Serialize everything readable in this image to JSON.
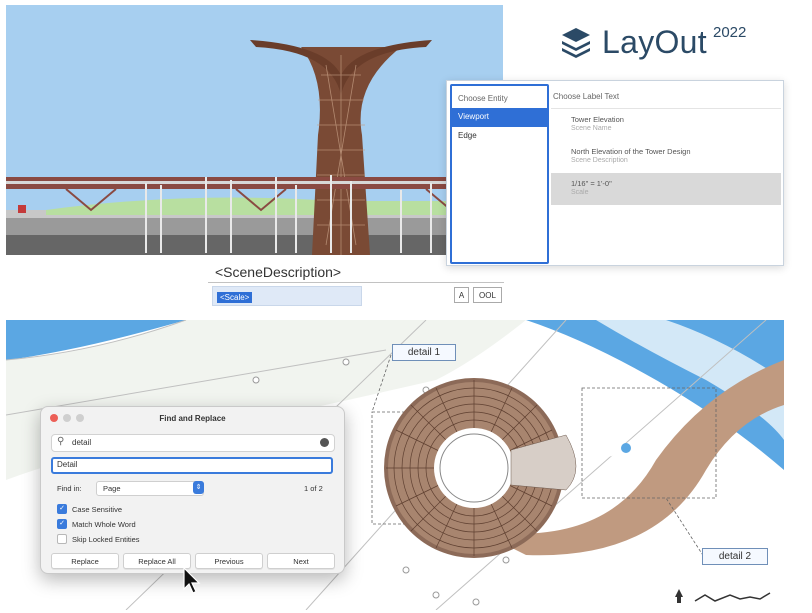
{
  "brand": {
    "name": "LayOut",
    "year": "2022",
    "icon": "layers-logo-icon",
    "color": "#2b4a66"
  },
  "label_tool": {
    "entity_header": "Choose Entity",
    "entities": [
      {
        "label": "Viewport",
        "selected": true
      },
      {
        "label": "Edge",
        "selected": false
      }
    ],
    "label_header": "Choose Label Text",
    "labels": [
      {
        "title": "Tower Elevation",
        "sub": "Scene Name",
        "selected": false
      },
      {
        "title": "North Elevation of the Tower Design",
        "sub": "Scene Description",
        "selected": false
      },
      {
        "title": "1/16\" = 1'-0\"",
        "sub": "Scale",
        "selected": true
      }
    ]
  },
  "text_editor": {
    "scene_description": "<SceneDescription>",
    "scale_token": "<Scale>",
    "btn_a": "A",
    "btn_ool": "OOL"
  },
  "detail_labels": {
    "d1": "detail 1",
    "d2": "detail 2"
  },
  "find_replace": {
    "title": "Find and Replace",
    "search_value": "detail",
    "replace_value": "Detail",
    "find_in_label": "Find in:",
    "find_in_value": "Page",
    "match_count": "1 of 2",
    "options": [
      {
        "label": "Case Sensitive",
        "checked": true
      },
      {
        "label": "Match Whole Word",
        "checked": true
      },
      {
        "label": "Skip Locked Entities",
        "checked": false
      }
    ],
    "buttons": {
      "replace": "Replace",
      "replace_all": "Replace All",
      "previous": "Previous",
      "next": "Next"
    }
  },
  "colors": {
    "accent": "#2f6fd6",
    "sky": "#a7cff0",
    "tower": "#7a4a35",
    "water": "#5ba7e3"
  }
}
